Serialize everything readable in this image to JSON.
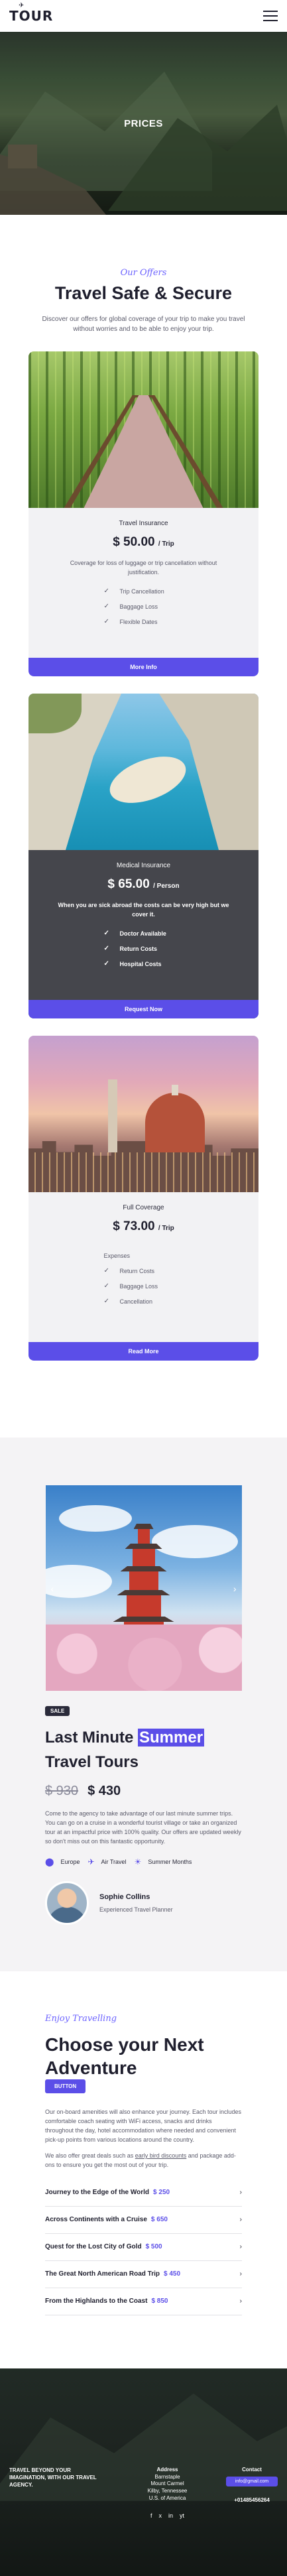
{
  "header": {
    "logo": "TOUR",
    "logo_icon": "airplane-icon",
    "menu_icon": "hamburger-menu-icon"
  },
  "hero": {
    "title": "PRICES"
  },
  "offers": {
    "eyebrow": "Our Offers",
    "title": "Travel Safe & Secure",
    "lead": "Discover our offers for global coverage of your trip to make you travel without worries and to be able to enjoy your trip.",
    "cards": [
      {
        "title": "Travel Insurance",
        "price": "$ 50.00",
        "per": "/ Trip",
        "description": "Coverage for loss of luggage or trip cancellation without justification.",
        "features": [
          "Trip Cancellation",
          "Baggage Loss",
          "Flexible Dates"
        ],
        "button": "More Info"
      },
      {
        "title": "Medical Insurance",
        "price": "$ 65.00",
        "per": "/ Person",
        "description": "When you are sick abroad the costs can be very high but we cover it.",
        "features": [
          "Doctor Available",
          "Return Costs",
          "Hospital Costs"
        ],
        "button": "Request Now"
      },
      {
        "title": "Full Coverage",
        "price": "$ 73.00",
        "per": "/ Trip",
        "description": "",
        "features": [
          "Expenses",
          "Return Costs",
          "Baggage Loss",
          "Cancellation"
        ],
        "button": "Read More"
      }
    ]
  },
  "tour": {
    "badge": "SALE",
    "title_part1": "Last Minute ",
    "title_hl": "Summer",
    "title_part2": " Travel Tours",
    "old_price": "$ 930",
    "new_price": "$ 430",
    "description": "Come to the agency to take advantage of our last minute summer trips. You can go on a cruise in a wonderful tourist village or take an organized tour at an impactful price with 100% quality. Our offers are updated weekly so don't miss out on this fantastic opportunity.",
    "meta": [
      {
        "icon": "location-pin-icon",
        "label": "Europe"
      },
      {
        "icon": "airplane-icon",
        "label": "Air Travel"
      },
      {
        "icon": "sun-icon",
        "label": "Summer Months"
      }
    ],
    "author_name": "Sophie Collins",
    "author_role": "Experienced Travel Planner"
  },
  "adventure": {
    "eyebrow": "Enjoy Travelling",
    "title": "Choose your Next Adventure",
    "button": "BUTTON",
    "text_a": "Our on-board amenities will also enhance your journey. Each tour includes comfortable coach seating with WiFi access, snacks and drinks throughout the day, hotel accommodation where needed and convenient pick-up points from various locations around the country.",
    "text_b1": "We also offer great deals such as ",
    "text_link": "early bird discounts",
    "text_b2": " and package add-ons to ensure you get the most out of your trip.",
    "tours": [
      {
        "name": "Journey to the Edge of the World",
        "price": "$ 250"
      },
      {
        "name": "Across Continents with a Cruise",
        "price": "$ 650"
      },
      {
        "name": "Quest for the Lost City of Gold",
        "price": "$ 500"
      },
      {
        "name": "The Great North American Road Trip",
        "price": "$ 450"
      },
      {
        "name": "From the Highlands to the Coast",
        "price": "$ 850"
      }
    ]
  },
  "footer": {
    "tagline": "TRAVEL BEYOND YOUR IMAGINATION, WITH OUR TRAVEL AGENCY.",
    "address_label": "Address",
    "address_lines": [
      "Barnstaple",
      "Mount Carmel",
      "Kilby, Tennessee",
      "U.S. of America"
    ],
    "socials": [
      "f",
      "x",
      "in",
      "yt"
    ],
    "contact_label": "Contact",
    "email": "info@gmail.com",
    "phone": "+01485456264"
  },
  "colors": {
    "accent": "#5b4ee8",
    "dark_card": "#45464c",
    "text_dark": "#1f1f2e"
  }
}
